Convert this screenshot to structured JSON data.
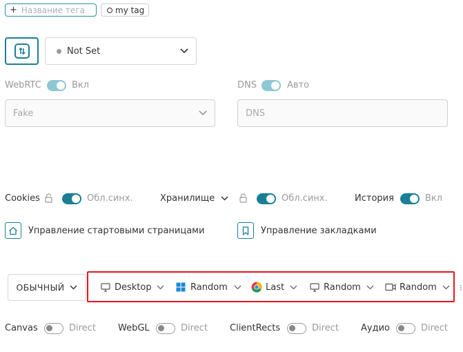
{
  "tags": {
    "add_placeholder": "Название тега",
    "chip_label": "my tag"
  },
  "proxy": {
    "select_value": "Not Set"
  },
  "webrtc": {
    "label": "WebRTC",
    "toggle_label": "Вкл",
    "select_value": "Fake"
  },
  "dns": {
    "label": "DNS",
    "toggle_label": "Авто",
    "input_placeholder": "DNS"
  },
  "sync": {
    "cookies_label": "Cookies",
    "cookies_mode": "Обл.синх.",
    "storage_label": "Хранилище",
    "storage_mode": "Обл.синх.",
    "history_label": "История",
    "history_mode": "Вкл"
  },
  "links": {
    "start_pages": "Управление стартовыми страницами",
    "bookmarks": "Управление закладками"
  },
  "fingerprint": {
    "mode": "ОБЫЧНЫЙ",
    "items": [
      "Desktop",
      "Random",
      "Last",
      "Random",
      "Random"
    ],
    "highlight_color": "#e8141e"
  },
  "noise": {
    "canvas_label": "Canvas",
    "canvas_mode": "Direct",
    "webgl_label": "WebGL",
    "webgl_mode": "Direct",
    "clientrects_label": "ClientRects",
    "clientrects_mode": "Direct",
    "audio_label": "Аудио",
    "audio_mode": "Direct"
  },
  "colors": {
    "accent": "#1a7f95",
    "highlight": "#e8141e",
    "muted": "#9a9a9a"
  }
}
